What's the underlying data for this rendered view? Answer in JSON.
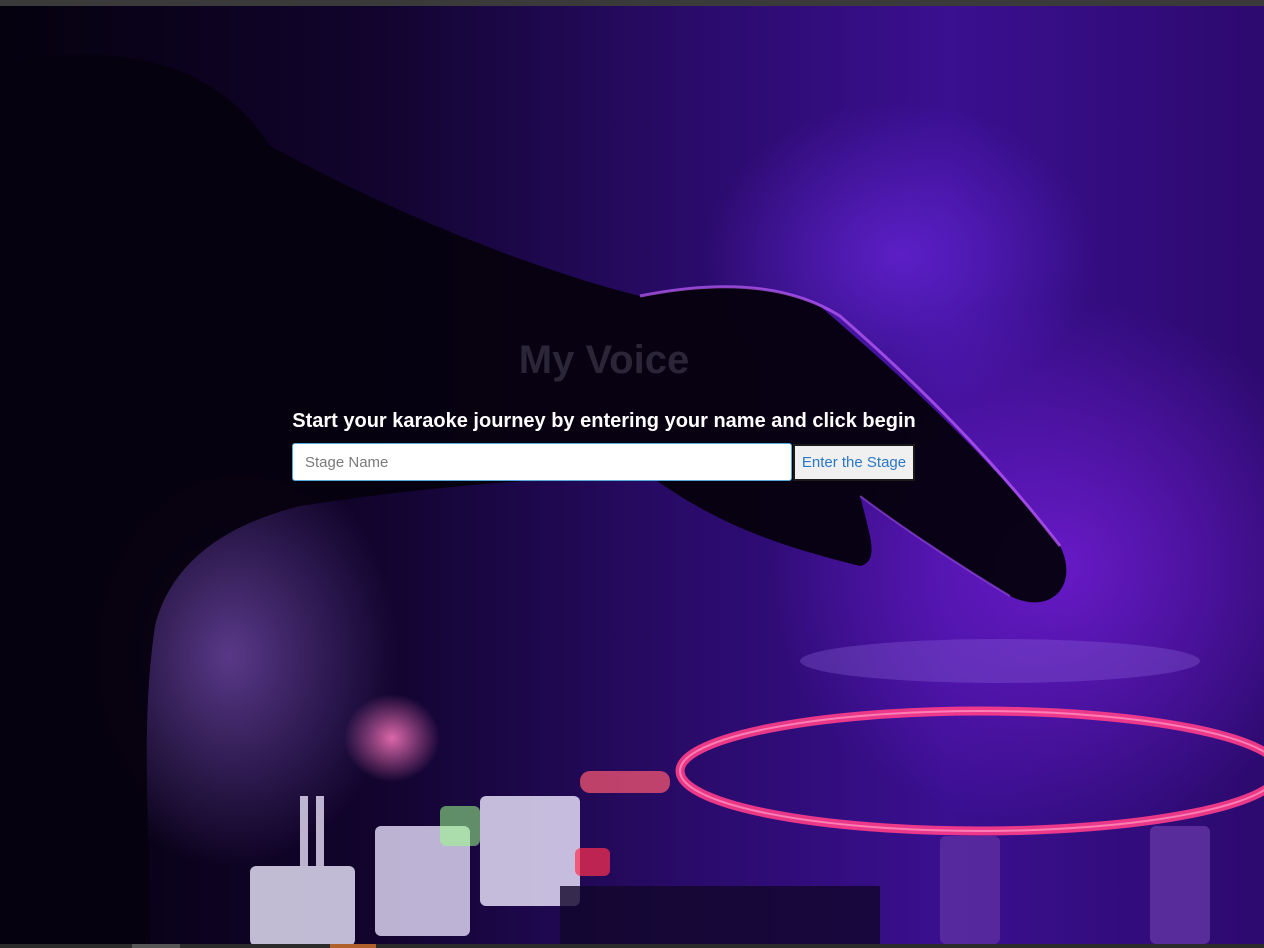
{
  "app": {
    "title": "My Voice",
    "instruction": "Start your karaoke journey by entering your name and click begin"
  },
  "form": {
    "stage_name_placeholder": "Stage Name",
    "stage_name_value": "",
    "submit_label": "Enter the Stage"
  },
  "colors": {
    "background_tint": "#3a0f90",
    "neon_ring": "#ff3d8a",
    "title_text": "#2a2638",
    "button_text": "#2a78c8"
  }
}
